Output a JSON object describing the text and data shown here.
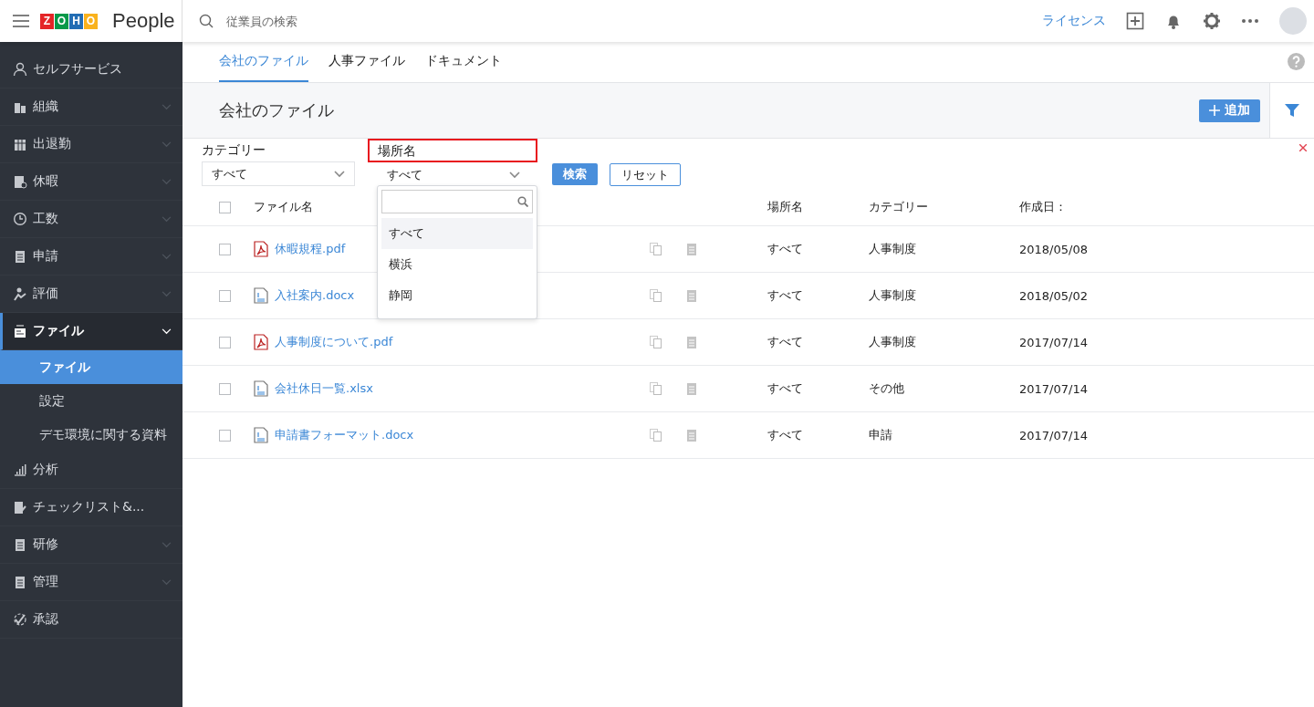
{
  "header": {
    "logo_letters": [
      "Z",
      "O",
      "H",
      "O"
    ],
    "product": "People",
    "search": {
      "placeholder": "従業員の検索"
    },
    "license_link": "ライセンス"
  },
  "sidebar": {
    "items": [
      {
        "label": "セルフサービス",
        "selected": false
      },
      {
        "label": "組織",
        "selected": false,
        "expanded": false
      },
      {
        "label": "出退勤",
        "selected": false,
        "expanded": false
      },
      {
        "label": "休暇",
        "selected": false,
        "expanded": false
      },
      {
        "label": "工数",
        "selected": false,
        "expanded": false
      },
      {
        "label": "申請",
        "selected": false,
        "expanded": false
      },
      {
        "label": "評価",
        "selected": false,
        "expanded": false
      },
      {
        "label": "ファイル",
        "selected": true,
        "expanded": true,
        "children": [
          {
            "label": "ファイル",
            "selected": true
          },
          {
            "label": "設定",
            "selected": false
          },
          {
            "label": "デモ環境に関する資料",
            "selected": false
          }
        ]
      },
      {
        "label": "分析",
        "selected": false
      },
      {
        "label": "チェックリスト&...",
        "selected": false
      },
      {
        "label": "研修",
        "selected": false,
        "expanded": false
      },
      {
        "label": "管理",
        "selected": false,
        "expanded": false
      },
      {
        "label": "承認",
        "selected": false
      }
    ]
  },
  "tabs": [
    {
      "label": "会社のファイル",
      "selected": true
    },
    {
      "label": "人事ファイル",
      "selected": false
    },
    {
      "label": "ドキュメント",
      "selected": false
    }
  ],
  "page_title": "会社のファイル",
  "add_button": "追加",
  "filters": [
    {
      "label": "カテゴリー",
      "value": "すべて",
      "highlighted": false,
      "open": false
    },
    {
      "label": "場所名",
      "value": "すべて",
      "highlighted": true,
      "open": true,
      "options": [
        {
          "label": "すべて",
          "selected": true
        },
        {
          "label": "横浜",
          "selected": false
        },
        {
          "label": "静岡",
          "selected": false
        }
      ]
    }
  ],
  "search_button": "検索",
  "reset_button": "リセット",
  "table": {
    "columns": [
      "ファイル名",
      "場所名",
      "カテゴリー",
      "作成日："
    ],
    "select_all_checked": false,
    "rows": [
      {
        "name": "休暇規程.pdf",
        "kind": "pdf",
        "location": "すべて",
        "category": "人事制度",
        "date": "2018/05/08",
        "checked": false
      },
      {
        "name": "入社案内.docx",
        "kind": "doc",
        "location": "すべて",
        "category": "人事制度",
        "date": "2018/05/02",
        "checked": false
      },
      {
        "name": "人事制度について.pdf",
        "kind": "pdf",
        "location": "すべて",
        "category": "人事制度",
        "date": "2017/07/14",
        "checked": false
      },
      {
        "name": "会社休日一覧.xlsx",
        "kind": "doc",
        "location": "すべて",
        "category": "その他",
        "date": "2017/07/14",
        "checked": false
      },
      {
        "name": "申請書フォーマット.docx",
        "kind": "doc",
        "location": "すべて",
        "category": "申請",
        "date": "2017/07/14",
        "checked": false
      }
    ]
  }
}
